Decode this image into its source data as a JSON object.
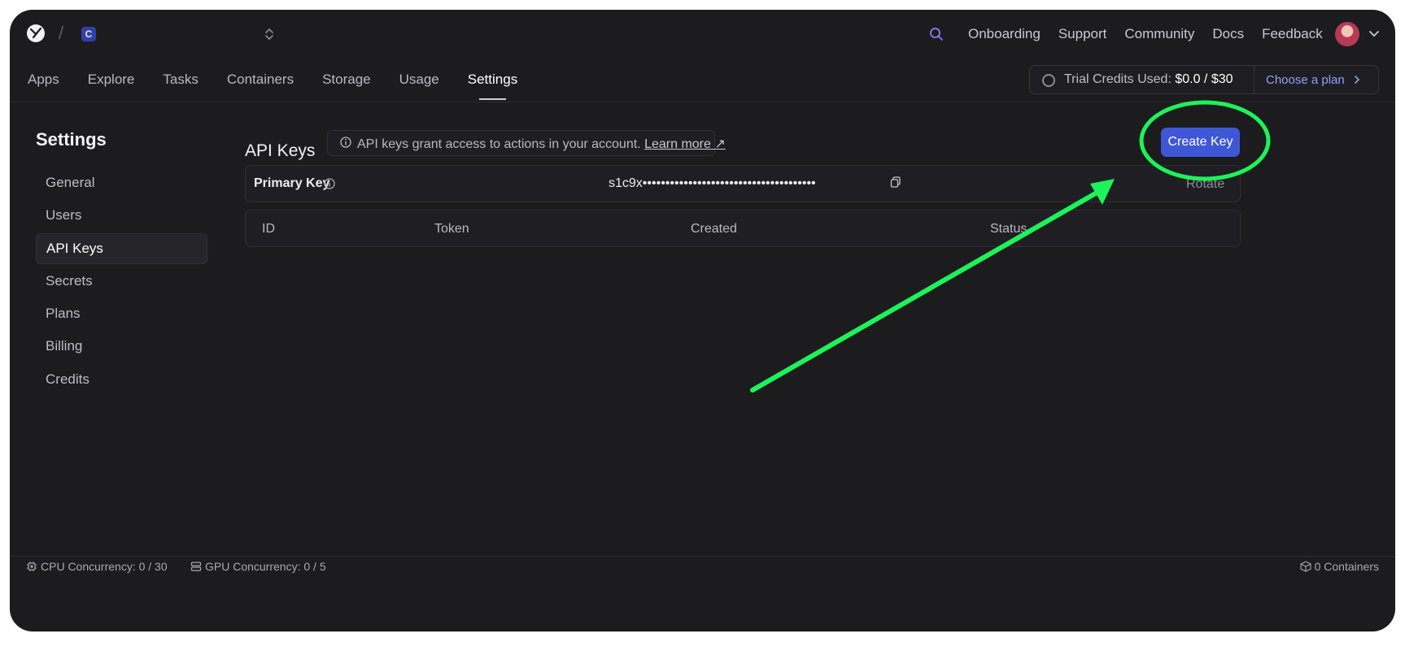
{
  "workspace": {
    "initial": "C"
  },
  "header": {
    "links": [
      "Onboarding",
      "Support",
      "Community",
      "Docs",
      "Feedback"
    ]
  },
  "nav": {
    "tabs": [
      "Apps",
      "Explore",
      "Tasks",
      "Containers",
      "Storage",
      "Usage",
      "Settings"
    ],
    "active_tab": "Settings"
  },
  "credits": {
    "label": "Trial Credits Used:",
    "value": "$0.0 / $30",
    "plan_button": "Choose a plan"
  },
  "sidebar": {
    "title": "Settings",
    "items": [
      {
        "label": "General"
      },
      {
        "label": "Users"
      },
      {
        "label": "API Keys"
      },
      {
        "label": "Secrets"
      },
      {
        "label": "Plans"
      },
      {
        "label": "Billing"
      },
      {
        "label": "Credits"
      }
    ],
    "active_item": "API Keys"
  },
  "content": {
    "heading": "API Keys",
    "info_text": "API keys grant access to actions in your account.",
    "learn_more": "Learn more ↗",
    "create_button": "Create Key",
    "primary_key": {
      "label": "Primary Key",
      "token": "s1c9x••••••••••••••••••••••••••••••••••••••",
      "rotate": "Rotate"
    },
    "table": {
      "columns": [
        "ID",
        "Token",
        "Created",
        "Status"
      ]
    }
  },
  "footer": {
    "cpu": "CPU Concurrency: 0 / 30",
    "gpu": "GPU Concurrency: 0 / 5",
    "containers": "0 Containers"
  },
  "colors": {
    "background": "#1c1c1f",
    "accent_button": "#3f57d6",
    "annotation_green": "#1ef25a",
    "link_blue": "#8fa0ff"
  }
}
